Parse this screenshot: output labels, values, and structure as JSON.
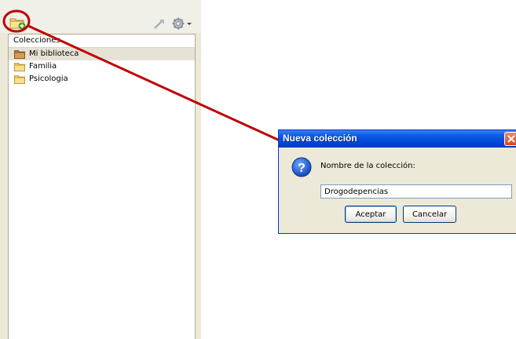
{
  "collections_pane": {
    "header": "Colecciones",
    "items": [
      {
        "label": "Mi biblioteca",
        "icon": "library-folder-icon",
        "selected": true
      },
      {
        "label": "Familia",
        "icon": "folder-icon",
        "selected": false
      },
      {
        "label": "Psicologia",
        "icon": "folder-icon",
        "selected": false
      }
    ]
  },
  "toolbar": {
    "new_collection_icon": "new-collection-icon",
    "sync_icon": "sync-icon",
    "settings_icon": "gear-icon"
  },
  "dialog": {
    "title": "Nueva colección",
    "prompt": "Nombre de la colección:",
    "input_value": "Drogodepencias",
    "accept_label": "Aceptar",
    "cancel_label": "Cancelar"
  },
  "colors": {
    "annotation": "#c00000",
    "title_bar": "#0a5ce6",
    "pane_background": "#ece9d8"
  }
}
